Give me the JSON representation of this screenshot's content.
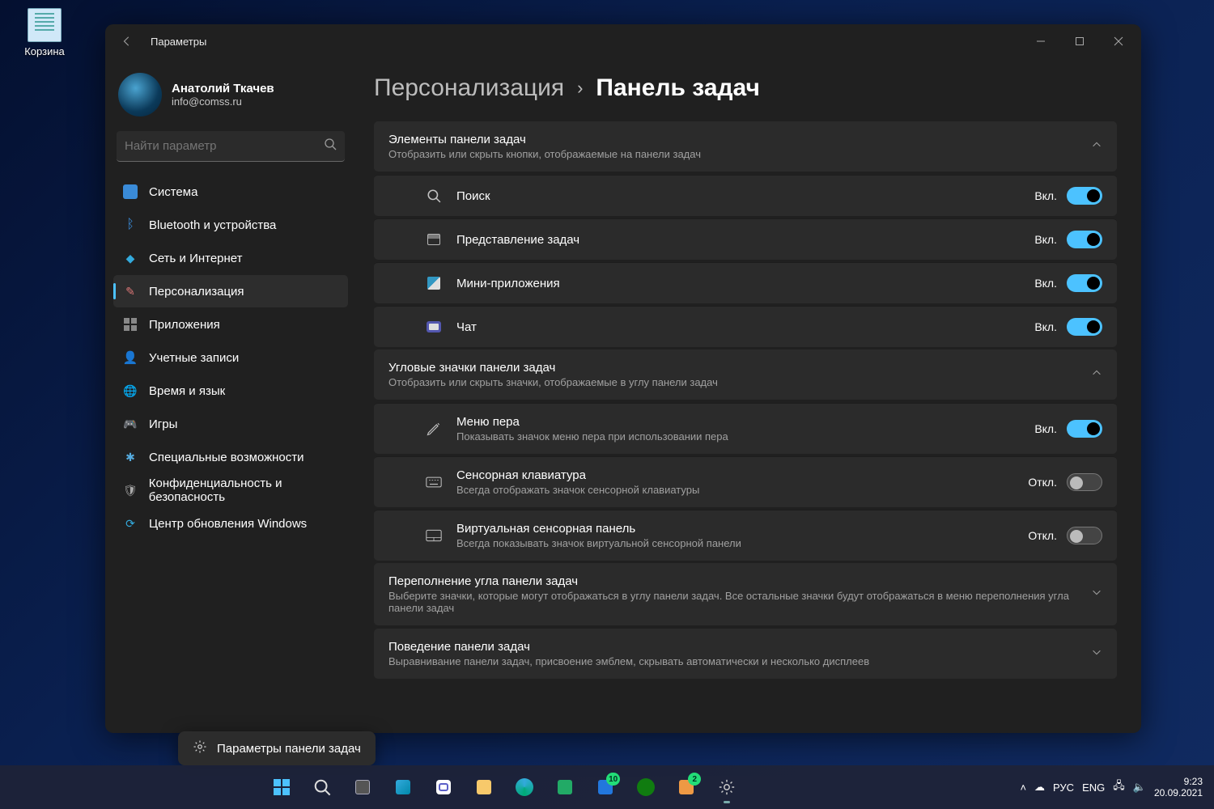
{
  "desktop": {
    "recycle_bin": "Корзина"
  },
  "window_title": "Параметры",
  "user": {
    "name": "Анатолий Ткачев",
    "email": "info@comss.ru"
  },
  "search_placeholder": "Найти параметр",
  "nav": [
    {
      "id": "system",
      "label": "Система"
    },
    {
      "id": "bluetooth",
      "label": "Bluetooth и устройства"
    },
    {
      "id": "network",
      "label": "Сеть и Интернет"
    },
    {
      "id": "personalization",
      "label": "Персонализация"
    },
    {
      "id": "apps",
      "label": "Приложения"
    },
    {
      "id": "accounts",
      "label": "Учетные записи"
    },
    {
      "id": "time",
      "label": "Время и язык"
    },
    {
      "id": "gaming",
      "label": "Игры"
    },
    {
      "id": "accessibility",
      "label": "Специальные возможности"
    },
    {
      "id": "privacy",
      "label": "Конфиденциальность и безопасность"
    },
    {
      "id": "update",
      "label": "Центр обновления Windows"
    }
  ],
  "nav_active": "personalization",
  "breadcrumb": {
    "parent": "Персонализация",
    "current": "Панель задач"
  },
  "sections": {
    "items": {
      "title": "Элементы панели задач",
      "sub": "Отобразить или скрыть кнопки, отображаемые на панели задач",
      "rows": [
        {
          "id": "search",
          "label": "Поиск",
          "state": "Вкл.",
          "on": true
        },
        {
          "id": "taskview",
          "label": "Представление задач",
          "state": "Вкл.",
          "on": true
        },
        {
          "id": "widgets",
          "label": "Мини-приложения",
          "state": "Вкл.",
          "on": true
        },
        {
          "id": "chat",
          "label": "Чат",
          "state": "Вкл.",
          "on": true
        }
      ]
    },
    "corner": {
      "title": "Угловые значки панели задач",
      "sub": "Отобразить или скрыть значки, отображаемые в углу панели задач",
      "rows": [
        {
          "id": "pen",
          "label": "Меню пера",
          "sub": "Показывать значок меню пера при использовании пера",
          "state": "Вкл.",
          "on": true
        },
        {
          "id": "touchkbd",
          "label": "Сенсорная клавиатура",
          "sub": "Всегда отображать значок сенсорной клавиатуры",
          "state": "Откл.",
          "on": false
        },
        {
          "id": "touchpad",
          "label": "Виртуальная сенсорная панель",
          "sub": "Всегда показывать значок виртуальной сенсорной панели",
          "state": "Откл.",
          "on": false
        }
      ]
    },
    "overflow": {
      "title": "Переполнение угла панели задач",
      "sub": "Выберите значки, которые могут отображаться в углу панели задач. Все остальные значки будут отображаться в меню переполнения угла панели задач"
    },
    "behavior": {
      "title": "Поведение панели задач",
      "sub": "Выравнивание панели задач, присвоение эмблем, скрывать автоматически и несколько дисплеев"
    }
  },
  "jumplist": {
    "label": "Параметры панели задач"
  },
  "tray": {
    "lang1": "РУС",
    "lang2": "ENG",
    "time": "9:23",
    "date": "20.09.2021"
  },
  "taskbar_badges": {
    "tips": "10",
    "gethelp": "2"
  }
}
